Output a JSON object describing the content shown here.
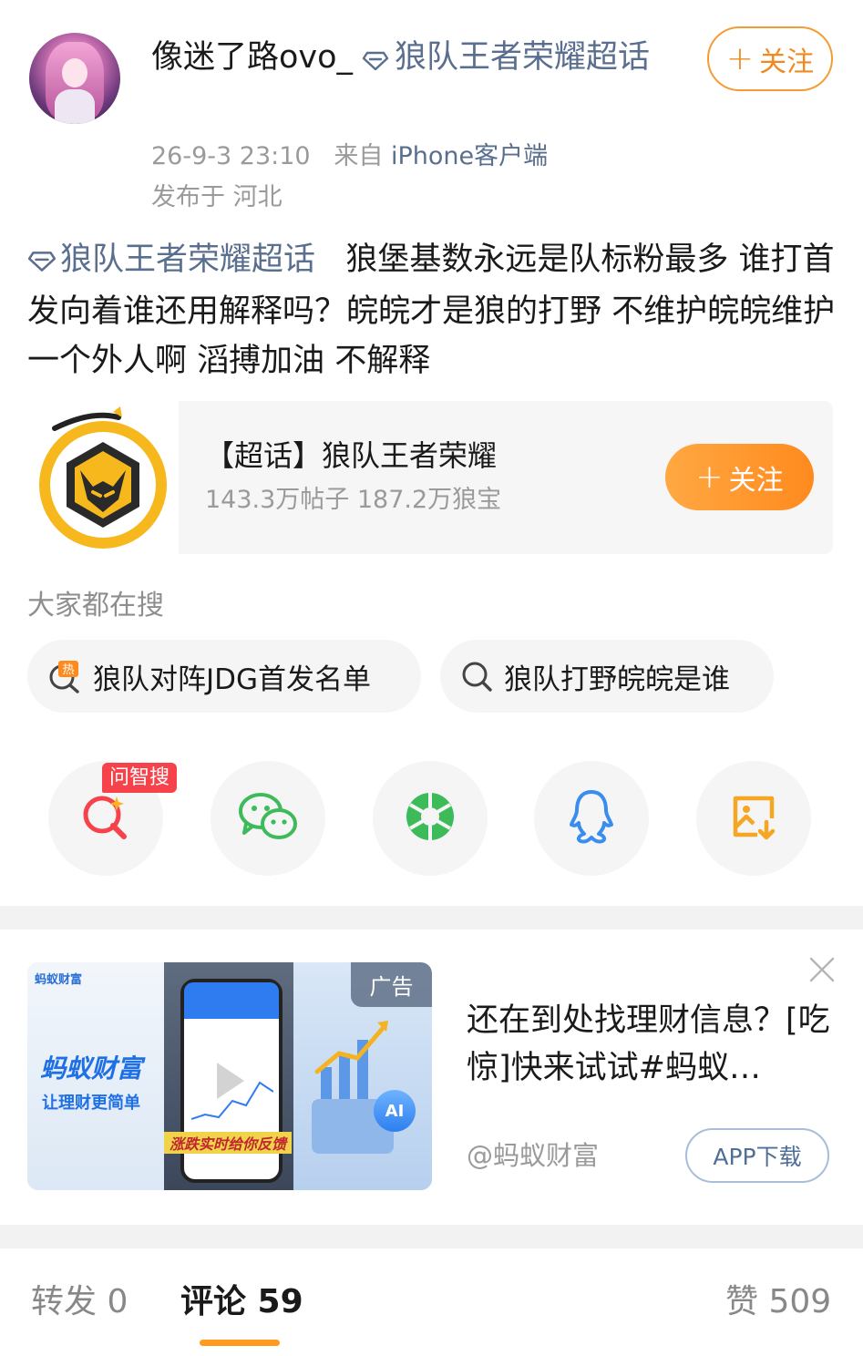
{
  "author": {
    "name": "像迷了路ovo_",
    "topic": "狼队王者荣耀超话",
    "follow_label": "关注",
    "timestamp": "26-9-3 23:10",
    "source_prefix": "来自",
    "source": "iPhone客户端",
    "location": "发布于 河北"
  },
  "post": {
    "topic_link": "狼队王者荣耀超话",
    "text": "狼堡基数永远是队标粉最多 谁打首发向着谁还用解释吗？皖皖才是狼的打野 不维护皖皖维护一个外人啊 滔搏加油 不解释"
  },
  "topic_card": {
    "name": "【超话】狼队王者荣耀",
    "stats": "143.3万帖子 187.2万狼宝",
    "follow_label": "关注"
  },
  "search": {
    "title": "大家都在搜",
    "chips": [
      {
        "label": "狼队对阵JDG首发名单",
        "icon": "hot-search-icon"
      },
      {
        "label": "狼队打野皖皖是谁",
        "icon": "search-icon"
      }
    ]
  },
  "share": {
    "badge": "问智搜",
    "items": [
      "ask-search-icon",
      "wechat-icon",
      "moments-icon",
      "qq-icon",
      "save-image-icon"
    ]
  },
  "ad": {
    "label": "广告",
    "brand_small": "蚂蚁财富",
    "brand_big": "蚂蚁财富",
    "slogan": "让理财更简单",
    "banner": "涨跌实时给你反馈",
    "ai_badge": "AI",
    "title": "还在到处找理财信息？[吃惊]快来试试#蚂蚁…",
    "source": "@蚂蚁财富",
    "download_label": "APP下载"
  },
  "tabs": {
    "repost": "转发 0",
    "comment": "评论 59",
    "like": "赞 509"
  },
  "colors": {
    "accent_orange": "#ff8a1e",
    "link_blue": "#5a6f8f",
    "badge_red": "#f5424b"
  }
}
